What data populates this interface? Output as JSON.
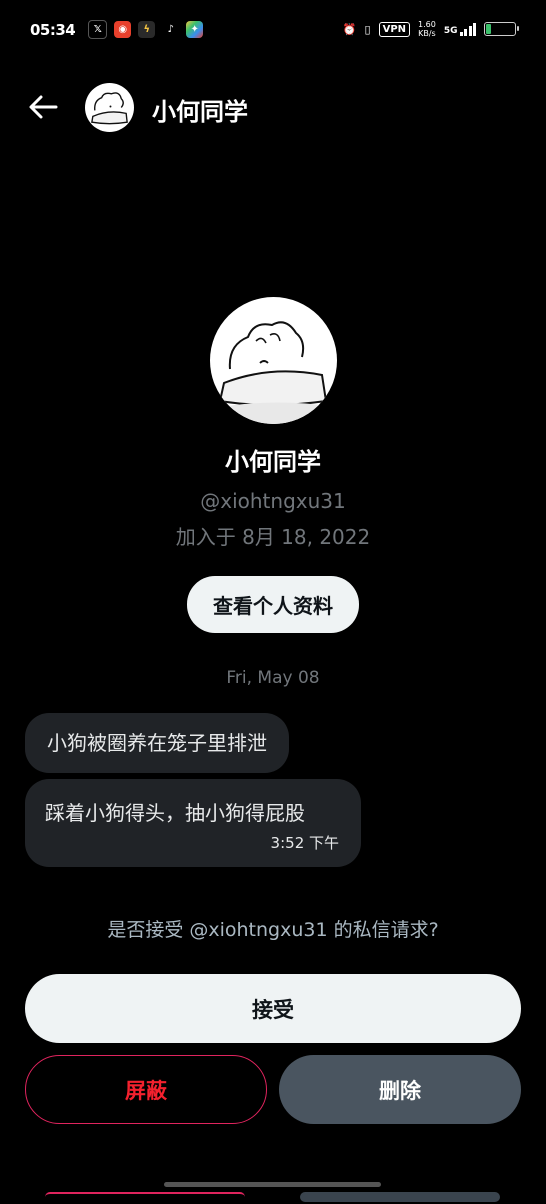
{
  "status_bar": {
    "time": "05:34",
    "vpn_label": "VPN",
    "net_speed_value": "1.60",
    "net_speed_unit": "KB/s",
    "network": "5G",
    "app_icons": [
      "x-icon",
      "red-app-icon",
      "charge-app-icon",
      "tiktok-icon",
      "colorful-app-icon"
    ]
  },
  "header": {
    "title": "小何同学"
  },
  "profile": {
    "name": "小何同学",
    "handle": "@xiohtngxu31",
    "joined": "加入于 8月 18, 2022",
    "view_profile_label": "查看个人资料"
  },
  "conversation": {
    "date": "Fri, May 08",
    "messages": [
      {
        "text": "小狗被圈养在笼子里排泄"
      },
      {
        "text": "踩着小狗得头，抽小狗得屁股",
        "time": "3:52 下午"
      }
    ]
  },
  "request": {
    "prompt": "是否接受 @xiohtngxu31 的私信请求?",
    "accept_label": "接受",
    "block_label": "屏蔽",
    "delete_label": "删除"
  },
  "colors": {
    "background": "#000000",
    "bubble": "#202327",
    "accept_bg": "#eff3f4",
    "block_border": "#e0245e",
    "delete_bg": "#4a5560",
    "muted_text": "#71767b"
  }
}
